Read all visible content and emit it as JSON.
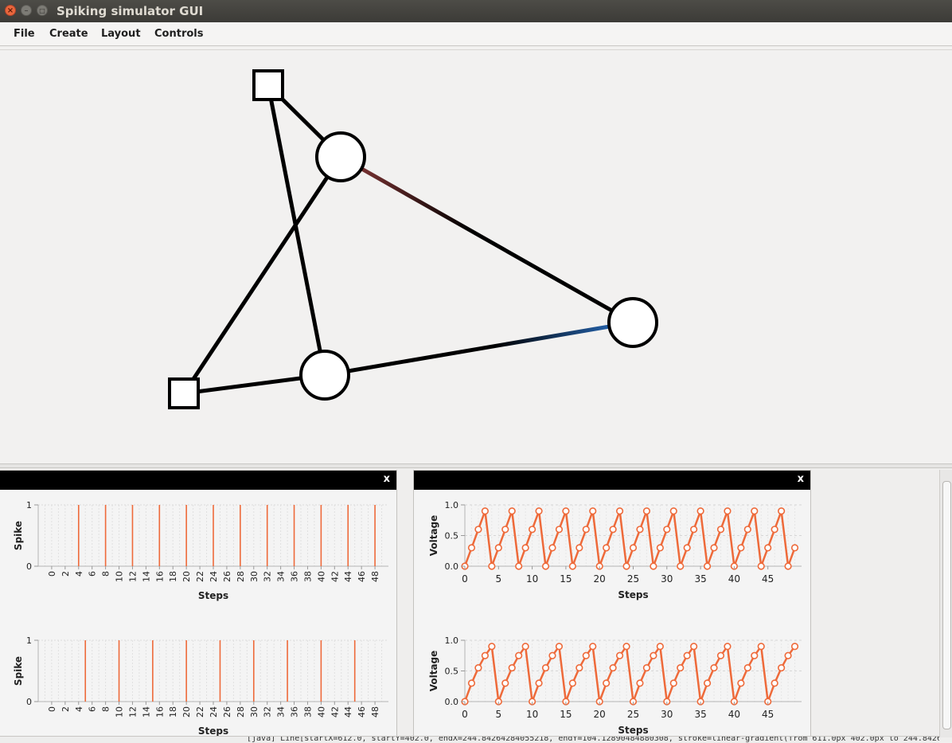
{
  "window": {
    "title": "Spiking simulator GUI"
  },
  "menu": [
    "File",
    "Create",
    "Layout",
    "Controls"
  ],
  "status_text": "[java] Line[startX=612.0, startY=402.0, endX=244.84264284055218, endY=104.12890484880308, stroke=linear-gradient(from 611.0px 402.0px to 244.84264",
  "colors": {
    "edge": "#000000",
    "excitatory_start": "#8b3a3a",
    "inhibitory_end": "#2a72c8",
    "series": "#ee6a3a"
  },
  "network": {
    "nodes": [
      {
        "id": "input-1",
        "shape": "square"
      },
      {
        "id": "input-2",
        "shape": "square"
      },
      {
        "id": "neuron-1",
        "shape": "circle"
      },
      {
        "id": "neuron-2",
        "shape": "circle"
      },
      {
        "id": "neuron-3",
        "shape": "circle"
      }
    ],
    "edges": [
      {
        "from": "input-1",
        "to": "neuron-1"
      },
      {
        "from": "input-1",
        "to": "neuron-3"
      },
      {
        "from": "input-2",
        "to": "neuron-1"
      },
      {
        "from": "input-2",
        "to": "neuron-3"
      },
      {
        "from": "neuron-1",
        "to": "neuron-2",
        "gradient": "excitatory"
      },
      {
        "from": "neuron-3",
        "to": "neuron-2",
        "gradient": "inhibitory"
      }
    ]
  },
  "panels": [
    {
      "close_label": "x"
    },
    {
      "close_label": "x"
    }
  ],
  "chart_data": [
    {
      "type": "bar",
      "xlabel": "Steps",
      "ylabel": "Spike",
      "ylim": [
        0,
        1
      ],
      "xlim": [
        -2,
        50
      ],
      "xticks": [
        0,
        2,
        4,
        6,
        8,
        10,
        12,
        14,
        16,
        18,
        20,
        22,
        24,
        26,
        28,
        30,
        32,
        34,
        36,
        38,
        40,
        42,
        44,
        46,
        48
      ],
      "yticks": [
        0,
        1
      ],
      "spikes_at": [
        4,
        8,
        12,
        16,
        20,
        24,
        28,
        32,
        36,
        40,
        44,
        48
      ]
    },
    {
      "type": "line",
      "xlabel": "Steps",
      "ylabel": "Voltage",
      "ylim": [
        0,
        1
      ],
      "xlim": [
        0,
        50
      ],
      "xticks": [
        0,
        5,
        10,
        15,
        20,
        25,
        30,
        35,
        40,
        45
      ],
      "yticks": [
        "0.0",
        "0.5",
        "1.0"
      ],
      "values": [
        0,
        0.3,
        0.6,
        0.9,
        0,
        0.3,
        0.6,
        0.9,
        0,
        0.3,
        0.6,
        0.9,
        0,
        0.3,
        0.6,
        0.9,
        0,
        0.3,
        0.6,
        0.9,
        0,
        0.3,
        0.6,
        0.9,
        0,
        0.3,
        0.6,
        0.9,
        0,
        0.3,
        0.6,
        0.9,
        0,
        0.3,
        0.6,
        0.9,
        0,
        0.3,
        0.6,
        0.9,
        0,
        0.3,
        0.6,
        0.9,
        0,
        0.3,
        0.6,
        0.9,
        0,
        0.3
      ]
    },
    {
      "type": "bar",
      "xlabel": "Steps",
      "ylabel": "Spike",
      "ylim": [
        0,
        1
      ],
      "xlim": [
        -2,
        50
      ],
      "xticks": [
        0,
        2,
        4,
        6,
        8,
        10,
        12,
        14,
        16,
        18,
        20,
        22,
        24,
        26,
        28,
        30,
        32,
        34,
        36,
        38,
        40,
        42,
        44,
        46,
        48
      ],
      "yticks": [
        0,
        1
      ],
      "spikes_at": [
        5,
        10,
        15,
        20,
        25,
        30,
        35,
        40,
        45
      ]
    },
    {
      "type": "line",
      "xlabel": "Steps",
      "ylabel": "Voltage",
      "ylim": [
        0,
        1
      ],
      "xlim": [
        0,
        50
      ],
      "xticks": [
        0,
        5,
        10,
        15,
        20,
        25,
        30,
        35,
        40,
        45
      ],
      "yticks": [
        "0.0",
        "0.5",
        "1.0"
      ],
      "values": [
        0,
        0.3,
        0.55,
        0.75,
        0.9,
        0,
        0.3,
        0.55,
        0.75,
        0.9,
        0,
        0.3,
        0.55,
        0.75,
        0.9,
        0,
        0.3,
        0.55,
        0.75,
        0.9,
        0,
        0.3,
        0.55,
        0.75,
        0.9,
        0,
        0.3,
        0.55,
        0.75,
        0.9,
        0,
        0.3,
        0.55,
        0.75,
        0.9,
        0,
        0.3,
        0.55,
        0.75,
        0.9,
        0,
        0.3,
        0.55,
        0.75,
        0.9,
        0,
        0.3,
        0.55,
        0.75,
        0.9
      ]
    }
  ]
}
